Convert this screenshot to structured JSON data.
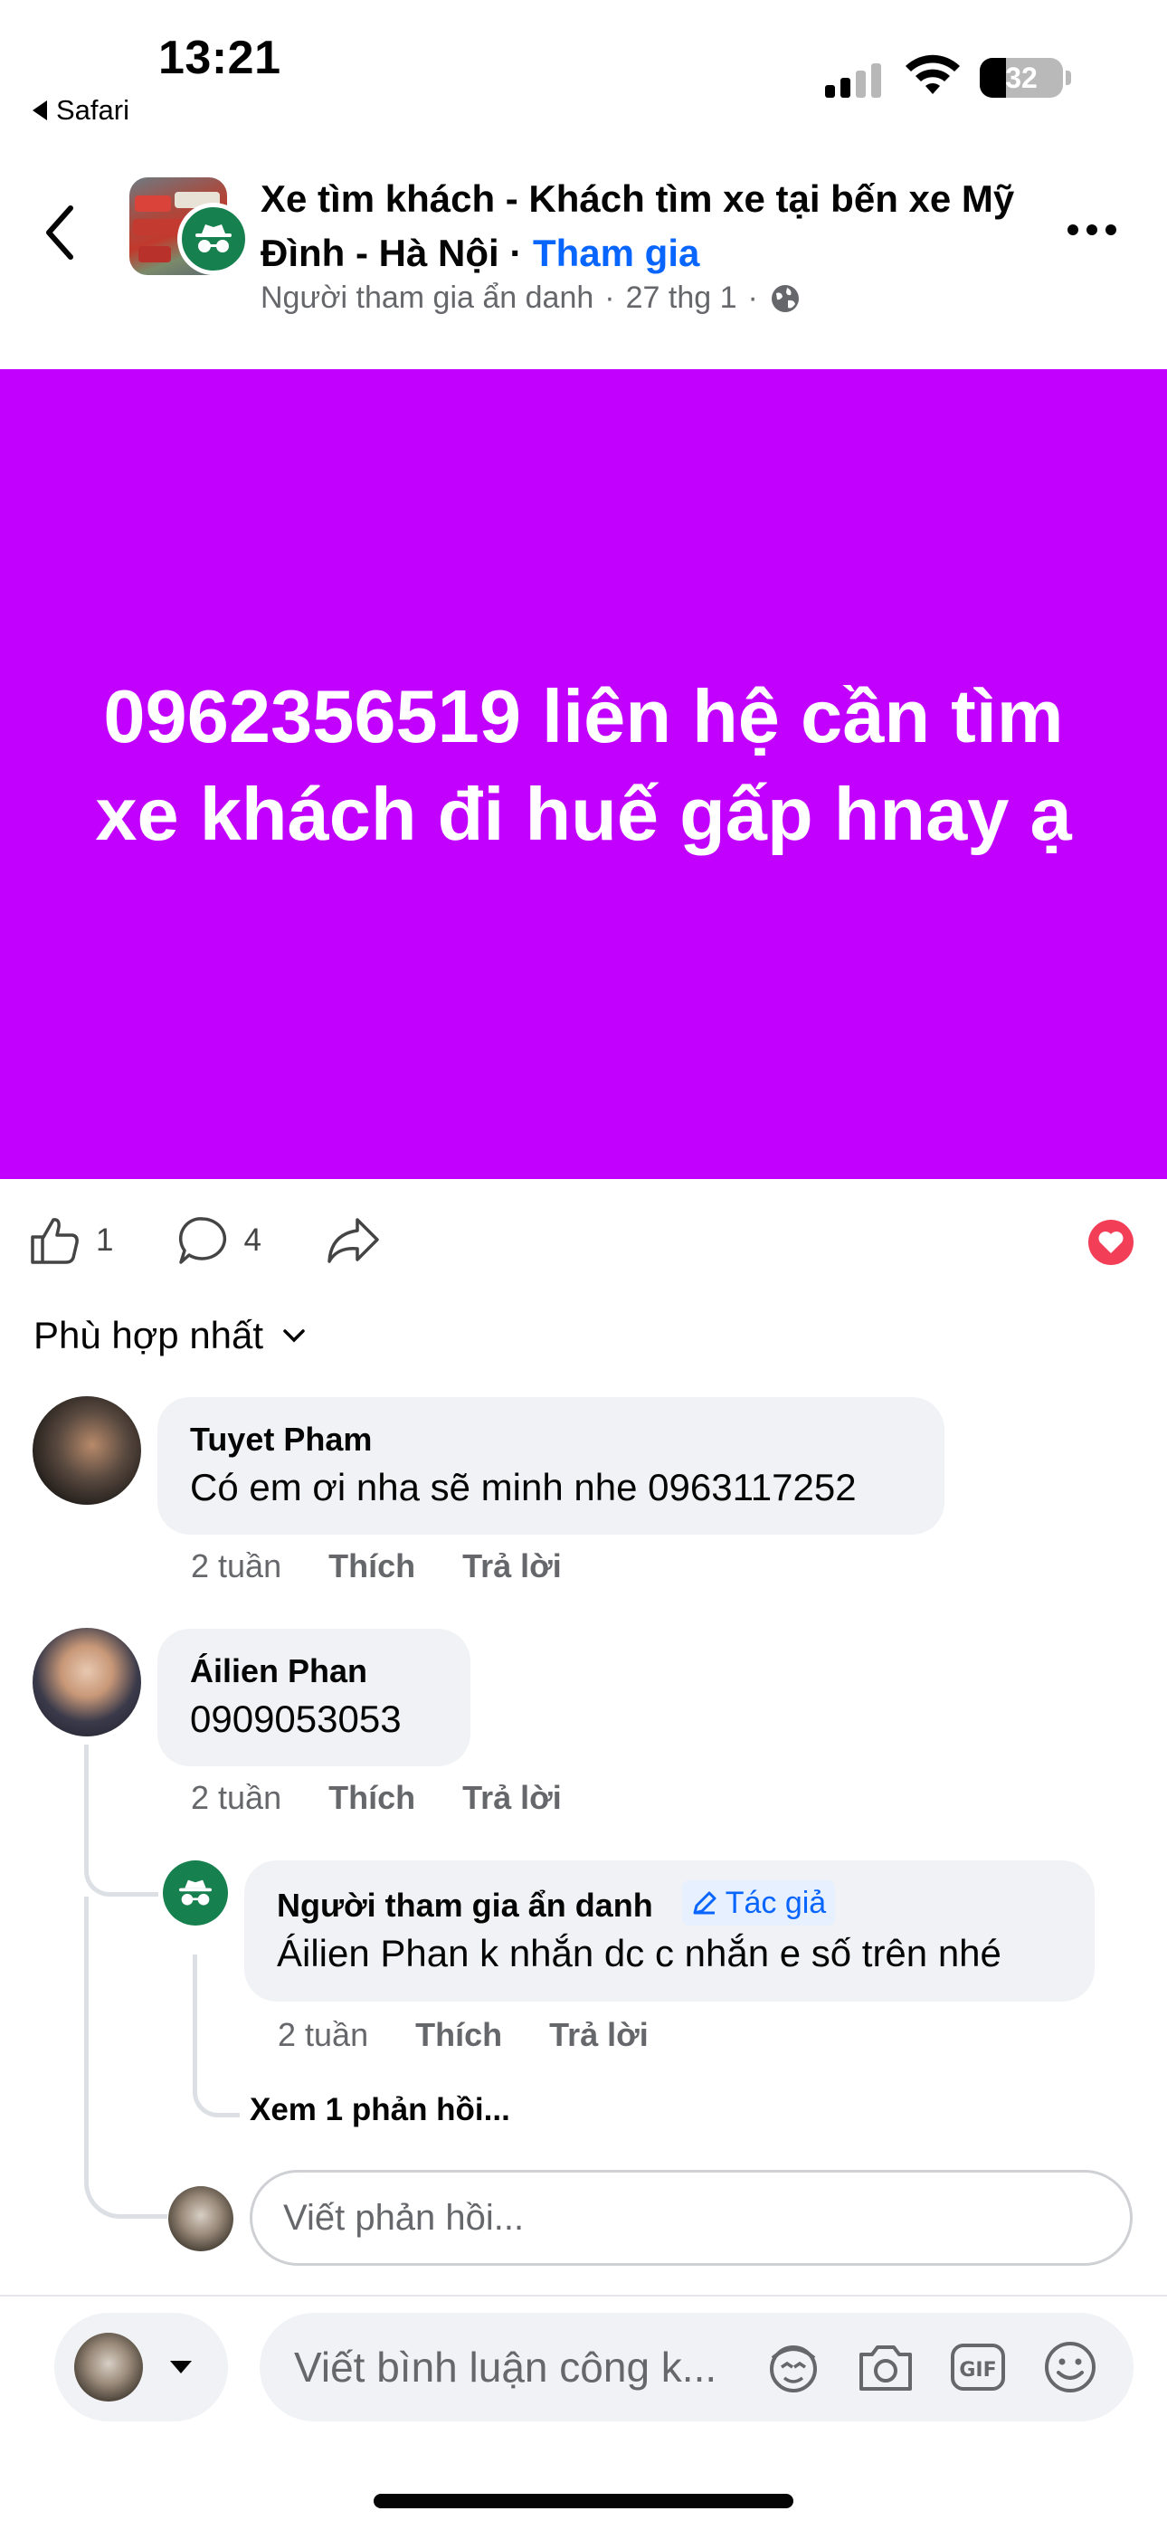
{
  "status_bar": {
    "time": "13:21",
    "back_app": "Safari",
    "battery": "32",
    "battery_level": 0.32
  },
  "header": {
    "group_name": "Xe tìm khách - Khách tìm xe tại bến xe Mỹ Đình - Hà Nội",
    "separator": " · ",
    "join_label": "Tham gia",
    "author": "Người tham gia ẩn danh",
    "meta_sep": "·",
    "date": "27 thg 1",
    "icons": {
      "back": "chevron-left-icon",
      "more": "more-dots-icon",
      "privacy": "globe-icon",
      "anon": "incognito-icon"
    }
  },
  "post": {
    "text": "0962356519 liên hệ cần tìm xe khách đi huế gấp hnay ạ",
    "background": "#c200fe"
  },
  "actions": {
    "like_count": "1",
    "comment_count": "4",
    "reaction_color": "#f33e58"
  },
  "sort": {
    "label": "Phù hợp nhất"
  },
  "comments": [
    {
      "name": "Tuyet Pham",
      "text": "Có em ơi nha sẽ minh nhe 0963117252",
      "time": "2 tuần",
      "like": "Thích",
      "reply": "Trả lời"
    },
    {
      "name": "Áilien Phan",
      "text": "0909053053",
      "time": "2 tuần",
      "like": "Thích",
      "reply": "Trả lời",
      "replies": [
        {
          "name": "Người tham gia ẩn danh",
          "badge": "Tác giả",
          "text": "Áilien Phan k nhắn dc c nhắn e số trên nhé",
          "time": "2 tuần",
          "like": "Thích",
          "reply": "Trả lời"
        }
      ],
      "view_more": "Xem 1 phản hồi...",
      "reply_placeholder": "Viết phản hồi..."
    }
  ],
  "composer": {
    "placeholder": "Viết bình luận công k...",
    "tools": [
      "avatar-sticker-icon",
      "camera-icon",
      "gif-icon",
      "emoji-icon"
    ],
    "accent": "#0866ff"
  }
}
